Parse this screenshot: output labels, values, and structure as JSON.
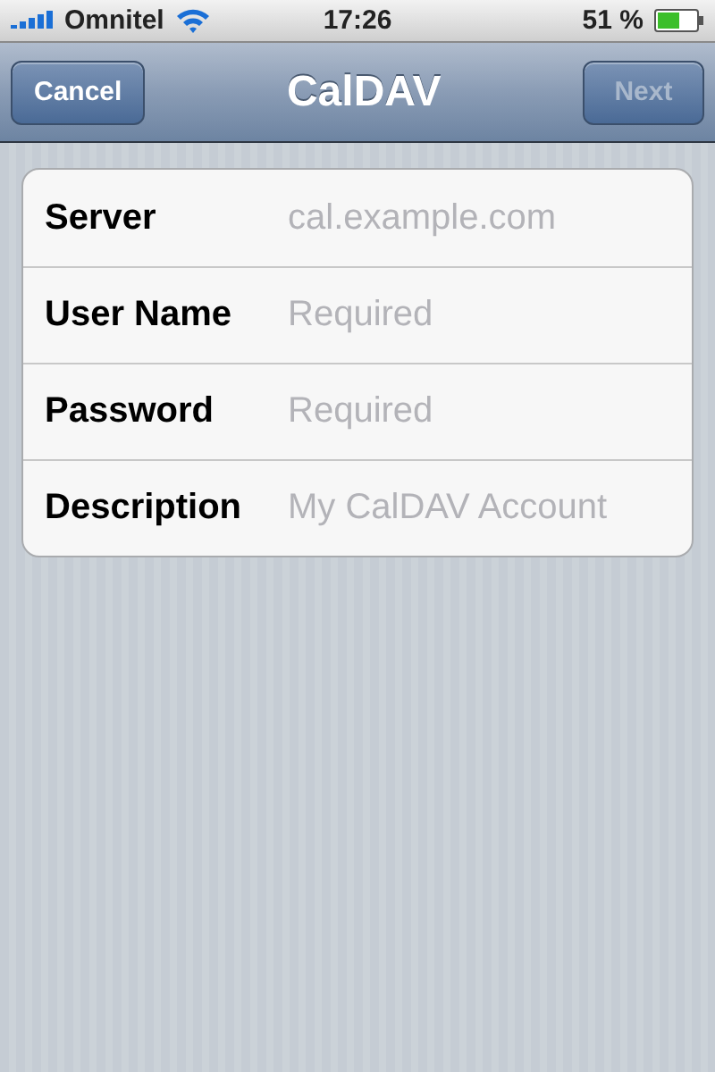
{
  "status_bar": {
    "carrier": "Omnitel",
    "time": "17:26",
    "battery": "51 %"
  },
  "nav_bar": {
    "title": "CalDAV",
    "left_button": {
      "label": "Cancel",
      "disabled": false
    },
    "right_button": {
      "label": "Next",
      "disabled": true
    }
  },
  "fields": [
    {
      "label": "Server",
      "placeholder": "cal.example.com"
    },
    {
      "label": "User Name",
      "placeholder": "Required"
    },
    {
      "label": "Password",
      "placeholder": "Required"
    },
    {
      "label": "Description",
      "placeholder": "My CalDAV Account"
    }
  ]
}
